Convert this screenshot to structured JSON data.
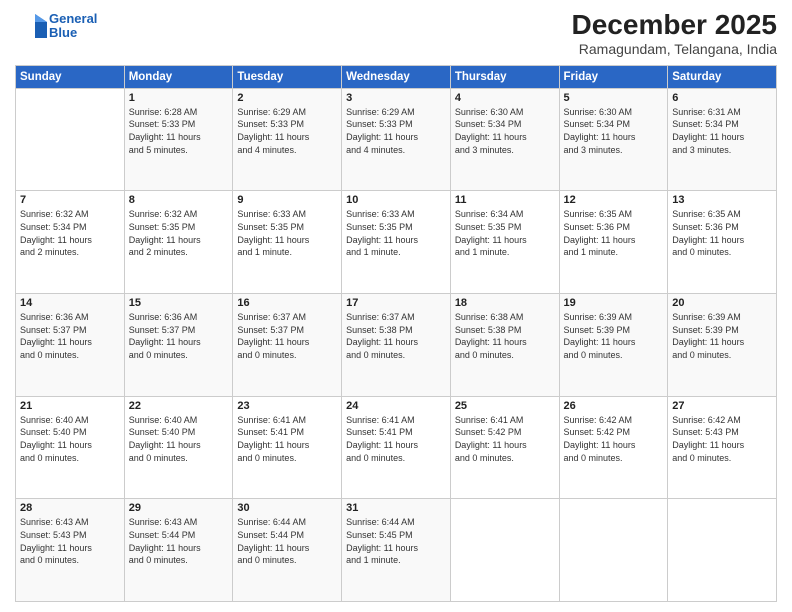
{
  "logo": {
    "line1": "General",
    "line2": "Blue"
  },
  "title": "December 2025",
  "location": "Ramagundam, Telangana, India",
  "days_of_week": [
    "Sunday",
    "Monday",
    "Tuesday",
    "Wednesday",
    "Thursday",
    "Friday",
    "Saturday"
  ],
  "weeks": [
    [
      {
        "day": "",
        "info": ""
      },
      {
        "day": "1",
        "info": "Sunrise: 6:28 AM\nSunset: 5:33 PM\nDaylight: 11 hours\nand 5 minutes."
      },
      {
        "day": "2",
        "info": "Sunrise: 6:29 AM\nSunset: 5:33 PM\nDaylight: 11 hours\nand 4 minutes."
      },
      {
        "day": "3",
        "info": "Sunrise: 6:29 AM\nSunset: 5:33 PM\nDaylight: 11 hours\nand 4 minutes."
      },
      {
        "day": "4",
        "info": "Sunrise: 6:30 AM\nSunset: 5:34 PM\nDaylight: 11 hours\nand 3 minutes."
      },
      {
        "day": "5",
        "info": "Sunrise: 6:30 AM\nSunset: 5:34 PM\nDaylight: 11 hours\nand 3 minutes."
      },
      {
        "day": "6",
        "info": "Sunrise: 6:31 AM\nSunset: 5:34 PM\nDaylight: 11 hours\nand 3 minutes."
      }
    ],
    [
      {
        "day": "7",
        "info": "Sunrise: 6:32 AM\nSunset: 5:34 PM\nDaylight: 11 hours\nand 2 minutes."
      },
      {
        "day": "8",
        "info": "Sunrise: 6:32 AM\nSunset: 5:35 PM\nDaylight: 11 hours\nand 2 minutes."
      },
      {
        "day": "9",
        "info": "Sunrise: 6:33 AM\nSunset: 5:35 PM\nDaylight: 11 hours\nand 1 minute."
      },
      {
        "day": "10",
        "info": "Sunrise: 6:33 AM\nSunset: 5:35 PM\nDaylight: 11 hours\nand 1 minute."
      },
      {
        "day": "11",
        "info": "Sunrise: 6:34 AM\nSunset: 5:35 PM\nDaylight: 11 hours\nand 1 minute."
      },
      {
        "day": "12",
        "info": "Sunrise: 6:35 AM\nSunset: 5:36 PM\nDaylight: 11 hours\nand 1 minute."
      },
      {
        "day": "13",
        "info": "Sunrise: 6:35 AM\nSunset: 5:36 PM\nDaylight: 11 hours\nand 0 minutes."
      }
    ],
    [
      {
        "day": "14",
        "info": "Sunrise: 6:36 AM\nSunset: 5:37 PM\nDaylight: 11 hours\nand 0 minutes."
      },
      {
        "day": "15",
        "info": "Sunrise: 6:36 AM\nSunset: 5:37 PM\nDaylight: 11 hours\nand 0 minutes."
      },
      {
        "day": "16",
        "info": "Sunrise: 6:37 AM\nSunset: 5:37 PM\nDaylight: 11 hours\nand 0 minutes."
      },
      {
        "day": "17",
        "info": "Sunrise: 6:37 AM\nSunset: 5:38 PM\nDaylight: 11 hours\nand 0 minutes."
      },
      {
        "day": "18",
        "info": "Sunrise: 6:38 AM\nSunset: 5:38 PM\nDaylight: 11 hours\nand 0 minutes."
      },
      {
        "day": "19",
        "info": "Sunrise: 6:39 AM\nSunset: 5:39 PM\nDaylight: 11 hours\nand 0 minutes."
      },
      {
        "day": "20",
        "info": "Sunrise: 6:39 AM\nSunset: 5:39 PM\nDaylight: 11 hours\nand 0 minutes."
      }
    ],
    [
      {
        "day": "21",
        "info": "Sunrise: 6:40 AM\nSunset: 5:40 PM\nDaylight: 11 hours\nand 0 minutes."
      },
      {
        "day": "22",
        "info": "Sunrise: 6:40 AM\nSunset: 5:40 PM\nDaylight: 11 hours\nand 0 minutes."
      },
      {
        "day": "23",
        "info": "Sunrise: 6:41 AM\nSunset: 5:41 PM\nDaylight: 11 hours\nand 0 minutes."
      },
      {
        "day": "24",
        "info": "Sunrise: 6:41 AM\nSunset: 5:41 PM\nDaylight: 11 hours\nand 0 minutes."
      },
      {
        "day": "25",
        "info": "Sunrise: 6:41 AM\nSunset: 5:42 PM\nDaylight: 11 hours\nand 0 minutes."
      },
      {
        "day": "26",
        "info": "Sunrise: 6:42 AM\nSunset: 5:42 PM\nDaylight: 11 hours\nand 0 minutes."
      },
      {
        "day": "27",
        "info": "Sunrise: 6:42 AM\nSunset: 5:43 PM\nDaylight: 11 hours\nand 0 minutes."
      }
    ],
    [
      {
        "day": "28",
        "info": "Sunrise: 6:43 AM\nSunset: 5:43 PM\nDaylight: 11 hours\nand 0 minutes."
      },
      {
        "day": "29",
        "info": "Sunrise: 6:43 AM\nSunset: 5:44 PM\nDaylight: 11 hours\nand 0 minutes."
      },
      {
        "day": "30",
        "info": "Sunrise: 6:44 AM\nSunset: 5:44 PM\nDaylight: 11 hours\nand 0 minutes."
      },
      {
        "day": "31",
        "info": "Sunrise: 6:44 AM\nSunset: 5:45 PM\nDaylight: 11 hours\nand 1 minute."
      },
      {
        "day": "",
        "info": ""
      },
      {
        "day": "",
        "info": ""
      },
      {
        "day": "",
        "info": ""
      }
    ]
  ]
}
